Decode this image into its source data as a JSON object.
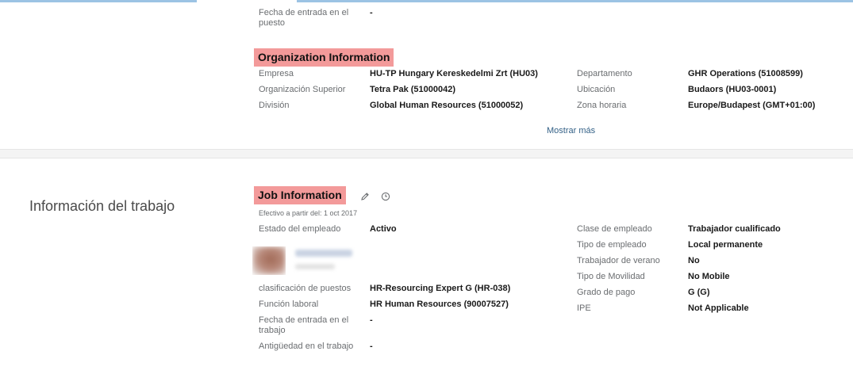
{
  "org_top": {
    "label": "Fecha de entrada en el puesto",
    "value": "-"
  },
  "organization": {
    "heading": "Organization Information",
    "left": [
      {
        "label": "Empresa",
        "value": "HU-TP Hungary Kereskedelmi Zrt (HU03)"
      },
      {
        "label": "Organización Superior",
        "value": "Tetra Pak (51000042)"
      },
      {
        "label": "División",
        "value": "Global Human Resources (51000052)"
      }
    ],
    "right": [
      {
        "label": "Departamento",
        "value": "GHR Operations (51008599)"
      },
      {
        "label": "Ubicación",
        "value": "Budaors (HU03-0001)"
      },
      {
        "label": "Zona horaria",
        "value": "Europe/Budapest (GMT+01:00)"
      }
    ],
    "show_more": "Mostrar más"
  },
  "job_section": {
    "title": "Información del trabajo",
    "heading": "Job Information",
    "effective": "Efectivo a partir del: 1 oct 2017",
    "status": {
      "label": "Estado del empleado",
      "value": "Activo"
    },
    "left": [
      {
        "label": "clasificación de puestos",
        "value": "HR-Resourcing Expert G (HR-038)"
      },
      {
        "label": "Función laboral",
        "value": "HR Human Resources (90007527)"
      },
      {
        "label": "Fecha de entrada en el trabajo",
        "value": "-"
      },
      {
        "label": "Antigüedad en el trabajo",
        "value": "-"
      }
    ],
    "right": [
      {
        "label": "Clase de empleado",
        "value": "Trabajador cualificado"
      },
      {
        "label": "Tipo de empleado",
        "value": "Local permanente"
      },
      {
        "label": "Trabajador de verano",
        "value": "No"
      },
      {
        "label": "Tipo de Movilidad",
        "value": "No Mobile"
      },
      {
        "label": "Grado de pago",
        "value": "G (G)"
      },
      {
        "label": "IPE",
        "value": "Not Applicable"
      }
    ]
  },
  "icons": {
    "edit": "pencil-icon",
    "history": "clock-history-icon"
  },
  "colors": {
    "highlight": "#f39a9a",
    "link": "#346187",
    "top_bar": "#9cc3e4"
  }
}
